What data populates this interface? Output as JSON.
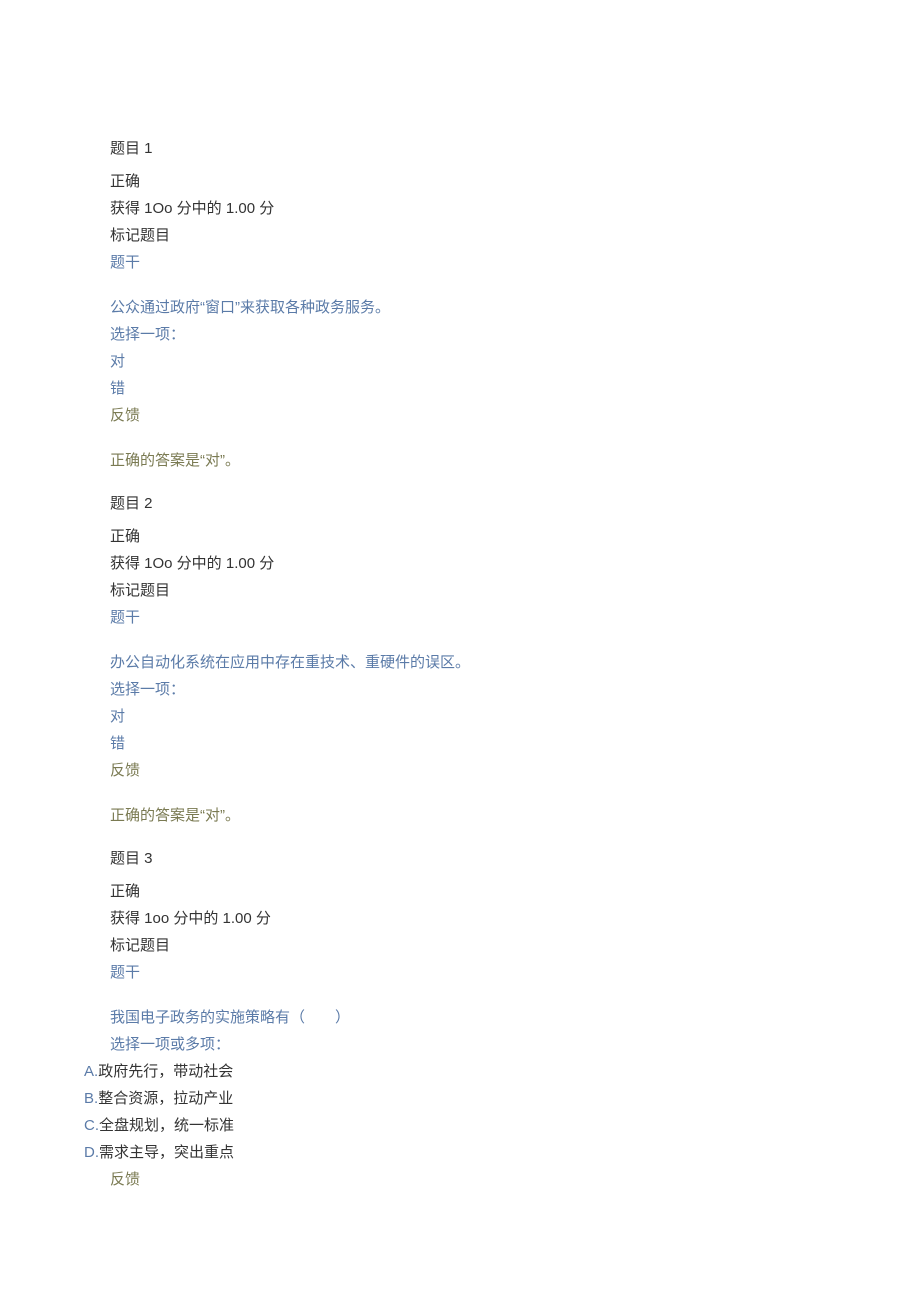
{
  "questions": [
    {
      "title": "题目 1",
      "status": "正确",
      "score": "获得 1Oo 分中的 1.00 分",
      "flag": "标记题目",
      "stemLabel": "题干",
      "stem": "公众通过政府“窗口”来获取各种政务服务。",
      "choosePrompt": "选择一项：",
      "options": [
        {
          "label": "对"
        },
        {
          "label": "错"
        }
      ],
      "feedbackLabel": "反馈",
      "answer": "正确的答案是“对”。"
    },
    {
      "title": "题目 2",
      "status": "正确",
      "score": "获得 1Oo 分中的 1.00 分",
      "flag": "标记题目",
      "stemLabel": "题干",
      "stem": "办公自动化系统在应用中存在重技术、重硬件的误区。",
      "choosePrompt": "选择一项：",
      "options": [
        {
          "label": "对"
        },
        {
          "label": "错"
        }
      ],
      "feedbackLabel": "反馈",
      "answer": "正确的答案是“对”。"
    },
    {
      "title": "题目 3",
      "status": "正确",
      "score": "获得 1oo 分中的 1.00 分",
      "flag": "标记题目",
      "stemLabel": "题干",
      "stem": "我国电子政务的实施策略有（　　）",
      "choosePrompt": "选择一项或多项：",
      "options": [
        {
          "letter": "A.",
          "label": "政府先行，带动社会"
        },
        {
          "letter": "B.",
          "label": "整合资源，拉动产业"
        },
        {
          "letter": "C.",
          "label": "全盘规划，统一标准"
        },
        {
          "letter": "D.",
          "label": "需求主导，突出重点"
        }
      ],
      "feedbackLabel": "反馈",
      "answer": ""
    }
  ]
}
